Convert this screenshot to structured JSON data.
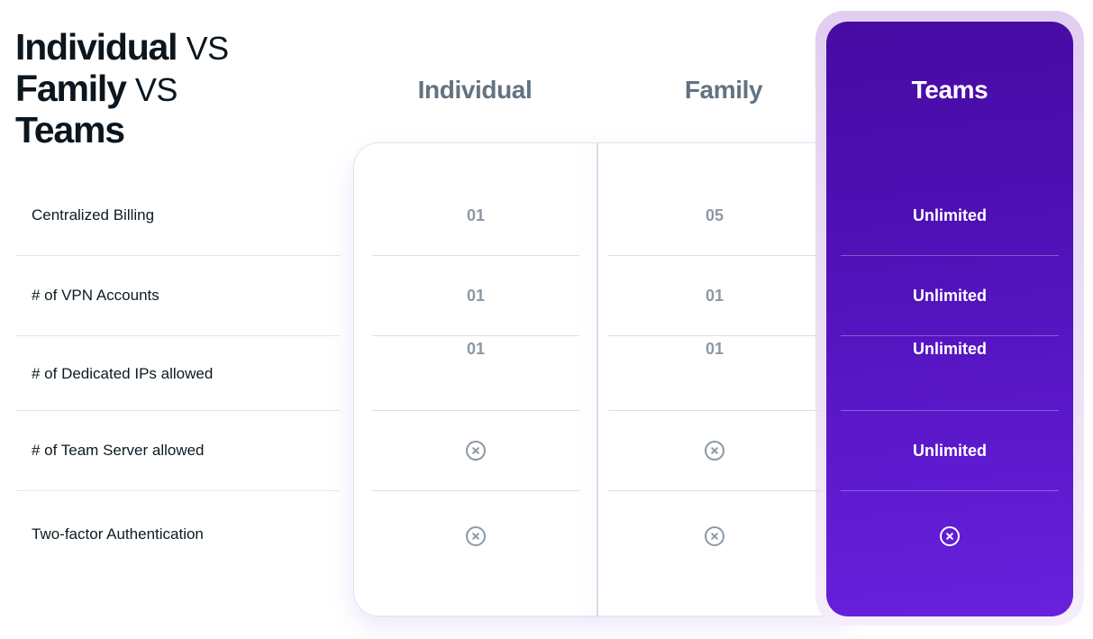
{
  "title": {
    "line1_bold": "Individual",
    "line1_light": "VS",
    "line2_bold": "Family",
    "line2_light": "VS",
    "line3_bold": "Teams"
  },
  "plans": [
    {
      "name": "Individual",
      "values": [
        "01",
        "01",
        "01",
        "x-circle-icon",
        "x-circle-icon"
      ]
    },
    {
      "name": "Family",
      "values": [
        "05",
        "01",
        "01",
        "x-circle-icon",
        "x-circle-icon"
      ]
    },
    {
      "name": "Teams",
      "values": [
        "Unlimited",
        "Unlimited",
        "Unlimited",
        "Unlimited",
        "x-circle-icon"
      ]
    }
  ],
  "features": [
    "Centralized Billing",
    "# of VPN Accounts",
    "# of Dedicated IPs allowed",
    "# of Team Server allowed",
    "Two-factor Authentication"
  ],
  "colors": {
    "teams_accent": "#4f10b5",
    "teams_accent_light": "#6820dc",
    "muted_value": "#8b98a6",
    "column_header": "#637381"
  }
}
